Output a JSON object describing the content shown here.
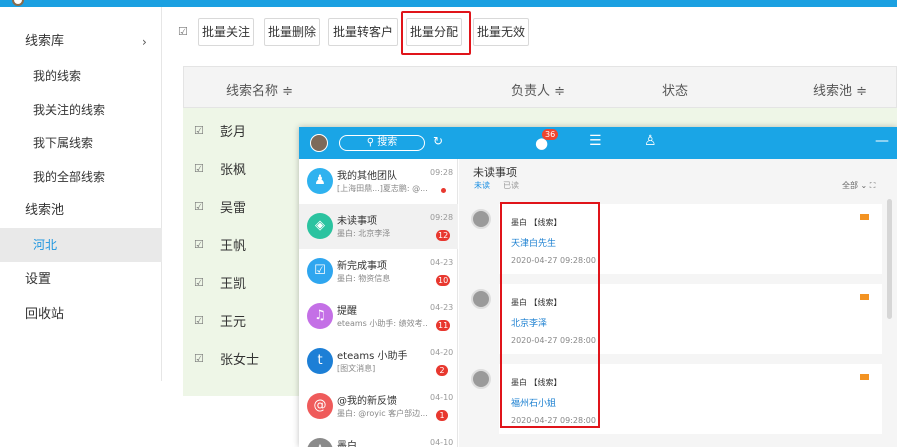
{
  "app": {
    "accent": "#1ba0e1"
  },
  "sidebar": {
    "items": [
      {
        "label": "线索库",
        "level": "top",
        "has_chevron": true,
        "active": false
      },
      {
        "label": "我的线索",
        "level": "sub",
        "active": false
      },
      {
        "label": "我关注的线索",
        "level": "sub",
        "active": false
      },
      {
        "label": "我下属线索",
        "level": "sub",
        "active": false
      },
      {
        "label": "我的全部线索",
        "level": "sub",
        "active": false
      },
      {
        "label": "线索池",
        "level": "top",
        "active": false
      },
      {
        "label": "河北",
        "level": "sub",
        "active": true
      },
      {
        "label": "设置",
        "level": "top",
        "active": false
      },
      {
        "label": "回收站",
        "level": "top",
        "active": false
      }
    ],
    "chevron": "›"
  },
  "toolbar": {
    "check_mark": "☑",
    "buttons": [
      "批量关注",
      "批量删除",
      "批量转客户",
      "批量分配",
      "批量无效"
    ],
    "highlighted": "批量分配"
  },
  "table": {
    "columns": [
      "线索名称 ≑",
      "负责人 ≑",
      "状态",
      "线索池 ≑"
    ],
    "rows": [
      {
        "name": "彭月"
      },
      {
        "name": "张枫"
      },
      {
        "name": "吴雷"
      },
      {
        "name": "王帆"
      },
      {
        "name": "王凯"
      },
      {
        "name": "王元"
      },
      {
        "name": "张女士"
      }
    ]
  },
  "chat": {
    "search_placeholder": "搜索",
    "message_badge": "36",
    "header_icons": [
      "refresh-icon",
      "chat-bubble-icon",
      "contacts-icon",
      "user-icon",
      "minimize-icon"
    ],
    "minimize": "—",
    "conversations": [
      {
        "title": "我的其他团队",
        "sub": "[上海田鼎...]夏志鹏: @...",
        "time": "09:28",
        "badge": "",
        "dot": true,
        "icon_color": "#2fb2ef",
        "icon": "♟"
      },
      {
        "title": "未读事项",
        "sub": "墨白: 北京李泽",
        "time": "09:28",
        "badge": "12",
        "dot": false,
        "icon_color": "#2bc3a0",
        "icon": "◈",
        "selected": true
      },
      {
        "title": "新完成事项",
        "sub": "墨白: 物资信息",
        "time": "04-23",
        "badge": "10",
        "dot": false,
        "icon_color": "#2fa6ef",
        "icon": "☑"
      },
      {
        "title": "提醒",
        "sub": "eteams 小助手: 绩效考...",
        "time": "04-23",
        "badge": "11",
        "dot": false,
        "icon_color": "#c470e6",
        "icon": "♫"
      },
      {
        "title": "eteams 小助手",
        "sub": "[图文消息]",
        "time": "04-20",
        "badge": "2",
        "dot": false,
        "icon_color": "#1d7fd6",
        "icon": "t"
      },
      {
        "title": "@我的新反馈",
        "sub": "墨白: @royic 客户部边...",
        "time": "04-10",
        "badge": "1",
        "dot": false,
        "icon_color": "#ef5b5b",
        "icon": "@"
      },
      {
        "title": "墨白",
        "sub": "",
        "time": "04-10",
        "badge": "",
        "dot": false,
        "icon_color": "#8a8a8a",
        "icon": "♙"
      }
    ],
    "detail": {
      "title": "未读事项",
      "tabs": [
        "未读",
        "已读"
      ],
      "filter": "全部 ⌄  ⛶",
      "cards": [
        {
          "from": "墨白 【线索】",
          "link": "天津白先生",
          "time": "2020-04-27 09:28:00"
        },
        {
          "from": "墨白 【线索】",
          "link": "北京李泽",
          "time": "2020-04-27 09:28:00"
        },
        {
          "from": "墨白 【线索】",
          "link": "福州石小姐",
          "time": "2020-04-27 09:28:00"
        }
      ]
    }
  }
}
